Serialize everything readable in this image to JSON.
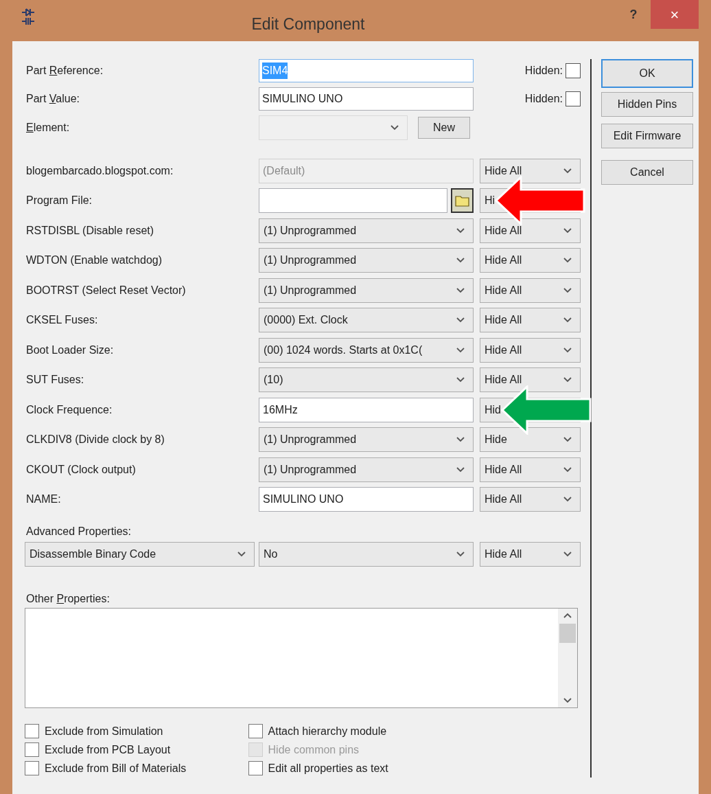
{
  "window": {
    "title": "Edit Component",
    "help_button": "?",
    "close_button": "×"
  },
  "top_fields": [
    {
      "label": {
        "before": "Part ",
        "key": "R",
        "after": "eference:"
      },
      "value": "SIM4",
      "text_selected": true,
      "hidden_label": "Hidden:",
      "hidden_checked": false
    },
    {
      "label": {
        "before": "Part ",
        "key": "V",
        "after": "alue:"
      },
      "value": "SIMULINO UNO",
      "text_selected": false,
      "hidden_label": "Hidden:",
      "hidden_checked": false
    }
  ],
  "element": {
    "label": {
      "key": "E",
      "after": "lement:"
    },
    "disabled": true,
    "new_button": "New"
  },
  "properties": [
    {
      "label": "blogembarcado.blogspot.com:",
      "kind": "text",
      "value": "(Default)",
      "disabled": true,
      "visibility": "Hide All"
    },
    {
      "label": "Program File:",
      "kind": "file",
      "disabled": false,
      "visibility": "Hi",
      "arrow": {
        "color": "#ff0000"
      }
    },
    {
      "label": "RSTDISBL (Disable reset)",
      "kind": "combo",
      "value": "(1) Unprogrammed",
      "disabled": false,
      "visibility": "Hide All"
    },
    {
      "label": "WDTON (Enable watchdog)",
      "kind": "combo",
      "value": "(1) Unprogrammed",
      "disabled": false,
      "visibility": "Hide All"
    },
    {
      "label": "BOOTRST (Select Reset Vector)",
      "kind": "combo",
      "value": "(1) Unprogrammed",
      "disabled": false,
      "visibility": "Hide All"
    },
    {
      "label": "CKSEL Fuses:",
      "kind": "combo",
      "value": "(0000) Ext. Clock",
      "disabled": false,
      "visibility": "Hide All"
    },
    {
      "label": "Boot Loader Size:",
      "kind": "combo",
      "value": "(00) 1024 words. Starts at 0x1C(",
      "disabled": false,
      "visibility": "Hide All"
    },
    {
      "label": "SUT Fuses:",
      "kind": "combo",
      "value": "(10)",
      "disabled": false,
      "visibility": "Hide All"
    },
    {
      "label": "Clock Frequence:",
      "kind": "text",
      "value": "16MHz",
      "disabled": false,
      "visibility": "Hid",
      "arrow": {
        "color": "#00a84f"
      }
    },
    {
      "label": "CLKDIV8 (Divide clock by 8)",
      "kind": "combo",
      "value": "(1) Unprogrammed",
      "disabled": false,
      "visibility": "Hide"
    },
    {
      "label": "CKOUT (Clock output)",
      "kind": "combo",
      "value": "(1) Unprogrammed",
      "disabled": false,
      "visibility": "Hide All"
    },
    {
      "label": "NAME:",
      "kind": "text",
      "value": "SIMULINO UNO",
      "disabled": false,
      "visibility": "Hide All"
    }
  ],
  "advanced": {
    "label": "Advanced Properties:",
    "property": "Disassemble Binary Code",
    "value": "No",
    "visibility": "Hide All"
  },
  "other": {
    "label": {
      "before": "Other ",
      "key": "P",
      "after": "roperties:"
    }
  },
  "checkboxes": [
    {
      "label": "Exclude from Simulation",
      "checked": false,
      "disabled": false
    },
    {
      "label": "Exclude from PCB Layout",
      "checked": false,
      "disabled": false
    },
    {
      "label": "Exclude from Bill of Materials",
      "checked": false,
      "disabled": false
    },
    {
      "label": "Attach hierarchy module",
      "checked": false,
      "disabled": false
    },
    {
      "label": "Hide common pins",
      "checked": false,
      "disabled": true
    },
    {
      "label": "Edit all properties as text",
      "checked": false,
      "disabled": false
    }
  ],
  "buttons": [
    {
      "label": "OK",
      "default": true
    },
    {
      "label": "Hidden Pins",
      "default": false
    },
    {
      "label": "Edit Firmware",
      "default": false
    },
    {
      "label": "Cancel",
      "default": false
    }
  ]
}
